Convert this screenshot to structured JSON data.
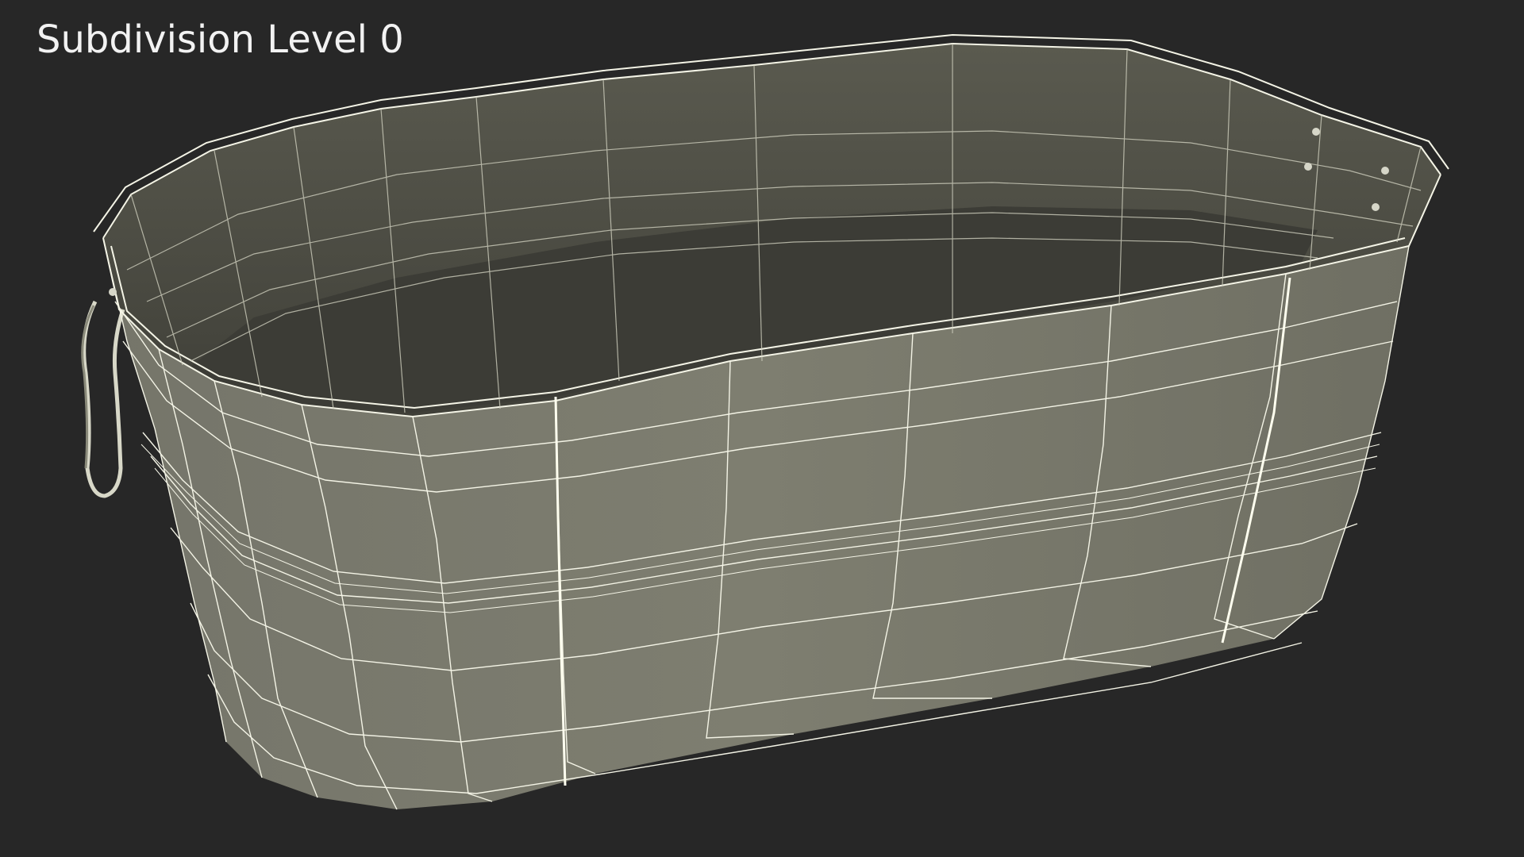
{
  "viewport": {
    "label": "Subdivision Level 0",
    "background": "#272727"
  },
  "model": {
    "subject": "oval-tub-icon",
    "outer_surface_color": "#7b7b6c",
    "inner_surface_color": "#5c5c50",
    "wire_color": "#f4f4e6"
  }
}
